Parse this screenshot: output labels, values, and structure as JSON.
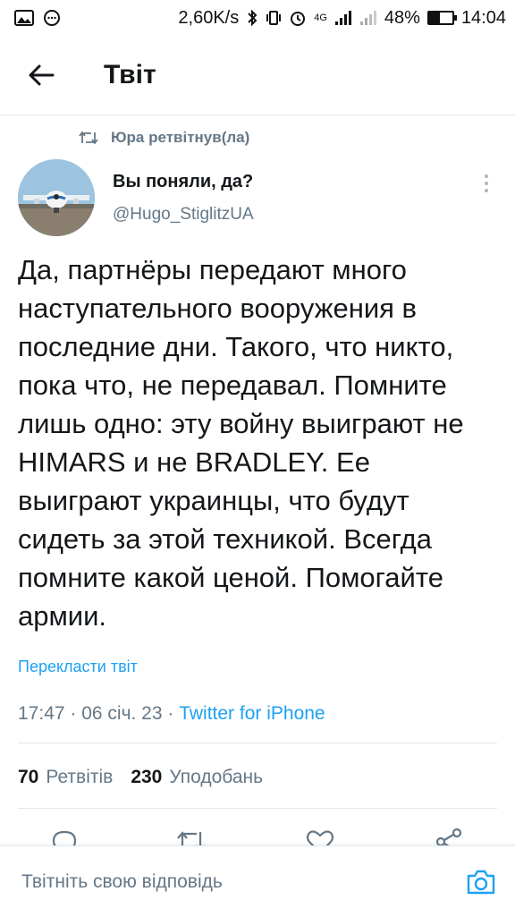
{
  "status_bar": {
    "speed": "2,60K/s",
    "network": "4G",
    "battery": "48%",
    "battery_level": 0.48,
    "time": "14:04"
  },
  "header": {
    "title": "Твіт",
    "back_icon": "arrow-left-icon"
  },
  "tweet": {
    "retweeted_by": "Юра ретвітнув(ла)",
    "display_name": "Вы поняли, да?",
    "username": "@Hugo_StiglitzUA",
    "text": "Да, партнёры передают много наступательного вооружения в последние дни. Такого, что никто, пока что, не передавал. Помните лишь одно: эту войну выиграют не HIMARS и не BRADLEY. Ее выиграют украинцы, что будут сидеть за этой техникой. Всегда помните какой ценой. Помогайте армии.",
    "translate_label": "Перекласти твіт",
    "timestamp": "17:47 · 06 січ. 23 · ",
    "source": "Twitter for iPhone",
    "retweets_count": "70",
    "retweets_label": "Ретвітів",
    "likes_count": "230",
    "likes_label": "Уподобань"
  },
  "reply": {
    "placeholder": "Твітніть свою відповідь"
  },
  "colors": {
    "accent": "#1da1f2",
    "secondary_text": "#657786",
    "divider": "#e1e8ed"
  }
}
